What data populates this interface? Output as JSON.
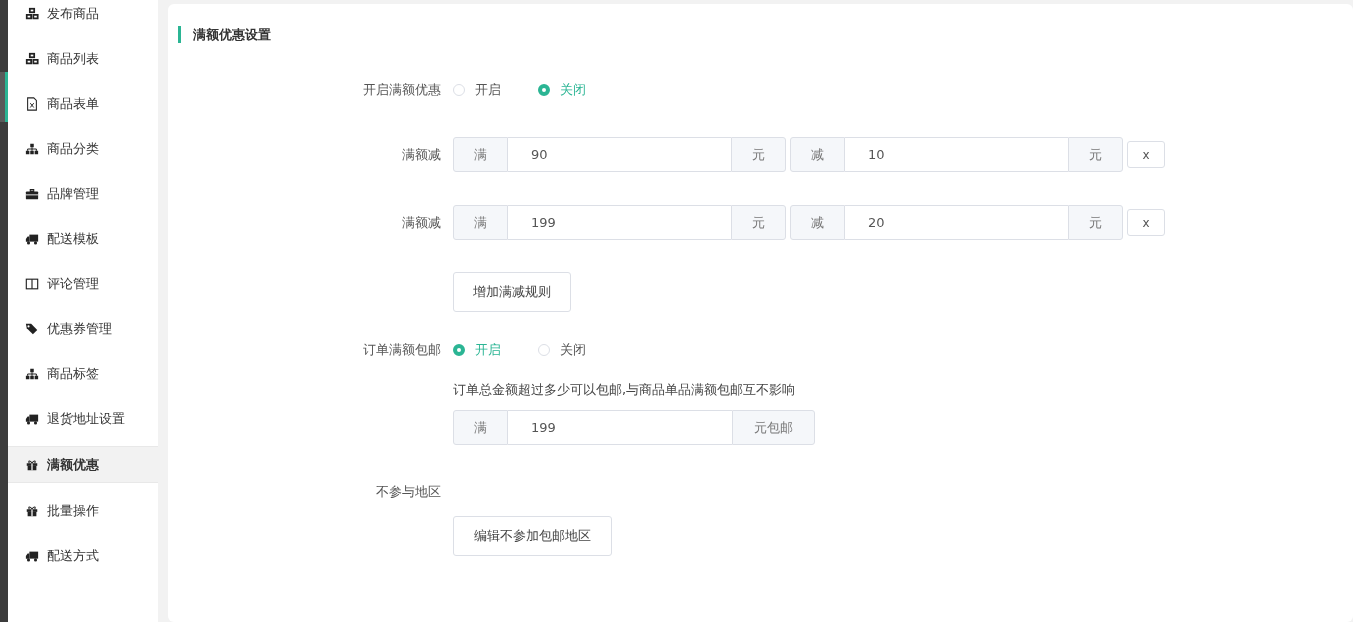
{
  "sidebar": {
    "items": [
      {
        "label": "发布商品",
        "kind": "cubes",
        "selected": false
      },
      {
        "label": "商品列表",
        "kind": "cubes",
        "selected": false
      },
      {
        "label": "商品表单",
        "kind": "file",
        "selected": false
      },
      {
        "label": "商品分类",
        "kind": "sitemap",
        "selected": false
      },
      {
        "label": "品牌管理",
        "kind": "briefcase",
        "selected": false
      },
      {
        "label": "配送模板",
        "kind": "truck",
        "selected": false
      },
      {
        "label": "评论管理",
        "kind": "columns",
        "selected": false
      },
      {
        "label": "优惠券管理",
        "kind": "tag",
        "selected": false
      },
      {
        "label": "商品标签",
        "kind": "sitemap",
        "selected": false
      },
      {
        "label": "退货地址设置",
        "kind": "truck",
        "selected": false
      },
      {
        "label": "满额优惠",
        "kind": "gift",
        "selected": true
      },
      {
        "label": "批量操作",
        "kind": "gift",
        "selected": false
      },
      {
        "label": "配送方式",
        "kind": "truck",
        "selected": false
      }
    ]
  },
  "section_title": "满额优惠设置",
  "discount_toggle": {
    "label": "开启满额优惠",
    "options": [
      {
        "label": "开启",
        "selected": false
      },
      {
        "label": "关闭",
        "selected": true
      }
    ]
  },
  "rules": [
    {
      "label": "满额减",
      "full_prefix": "满",
      "full_value": "90",
      "full_suffix": "元",
      "minus_prefix": "减",
      "minus_value": "10",
      "minus_suffix": "元",
      "remove": "x"
    },
    {
      "label": "满额减",
      "full_prefix": "满",
      "full_value": "199",
      "full_suffix": "元",
      "minus_prefix": "减",
      "minus_value": "20",
      "minus_suffix": "元",
      "remove": "x"
    }
  ],
  "add_rule_button": "增加满减规则",
  "free_shipping": {
    "label": "订单满额包邮",
    "options": [
      {
        "label": "开启",
        "selected": true
      },
      {
        "label": "关闭",
        "selected": false
      }
    ],
    "hint": "订单总金额超过多少可以包邮,与商品单品满额包邮互不影响",
    "prefix": "满",
    "value": "199",
    "suffix": "元包邮"
  },
  "excluded_regions": {
    "label": "不参与地区",
    "button": "编辑不参加包邮地区"
  }
}
